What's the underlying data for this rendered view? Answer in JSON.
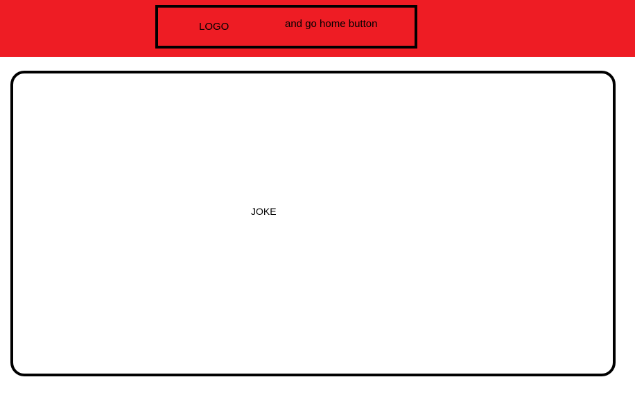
{
  "header": {
    "logo_label": "LOGO",
    "home_button_label": "and go home button",
    "background_color": "#ee1c24"
  },
  "main": {
    "joke_text": "JOKE"
  }
}
